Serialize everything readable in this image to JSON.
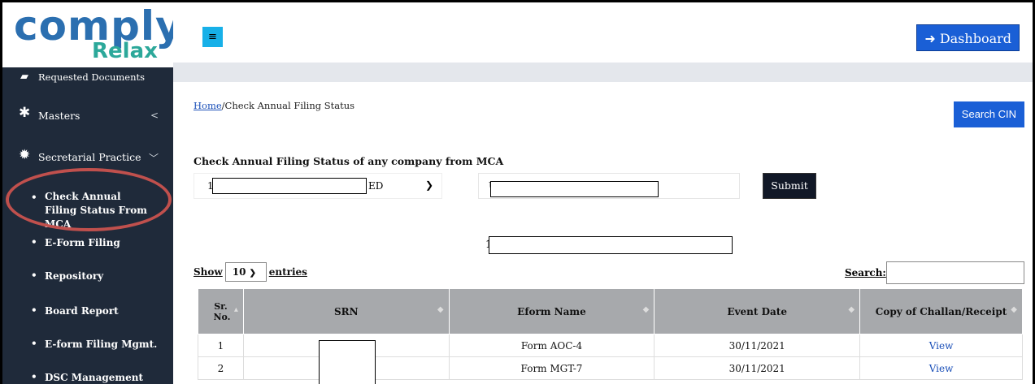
{
  "brand": {
    "name": "comply",
    "sub": "Relax"
  },
  "sidebar": {
    "items": [
      {
        "label": "Requested Documents",
        "icon": "book-icon"
      },
      {
        "label": "Masters",
        "icon": "asterisk-icon"
      },
      {
        "label": "Secretarial Practice",
        "icon": "gear-icon"
      }
    ],
    "subitems": [
      {
        "label": "Check Annual Filing Status From MCA"
      },
      {
        "label": "E-Form Filing"
      },
      {
        "label": "Repository"
      },
      {
        "label": "Board Report"
      },
      {
        "label": "E-form Filing Mgmt."
      },
      {
        "label": "DSC Management"
      }
    ]
  },
  "topbar": {
    "menu_icon": "≡",
    "dashboard_label": "Dashboard"
  },
  "breadcrumb": {
    "home": "Home",
    "current": "/Check Annual Filing Status"
  },
  "actions": {
    "search_cin": "Search CIN",
    "submit": "Submit"
  },
  "form": {
    "heading": "Check Annual Filing Status of any company from MCA",
    "select_prefix": "1",
    "select_suffix": "ED",
    "input_prefix": "U"
  },
  "company_prefix": "1",
  "datatable": {
    "show": "Show",
    "length": "10",
    "entries": "entries",
    "search_label": "Search:"
  },
  "table": {
    "headers": [
      "Sr. No.",
      "SRN",
      "Eform Name",
      "Event Date",
      "Copy of Challan/Receipt"
    ],
    "rows": [
      {
        "sr": "1",
        "srn": "",
        "eform": "Form AOC-4",
        "date": "30/11/2021",
        "copy": "View"
      },
      {
        "sr": "2",
        "srn": "",
        "eform": "Form MGT-7",
        "date": "30/11/2021",
        "copy": "View"
      }
    ]
  }
}
